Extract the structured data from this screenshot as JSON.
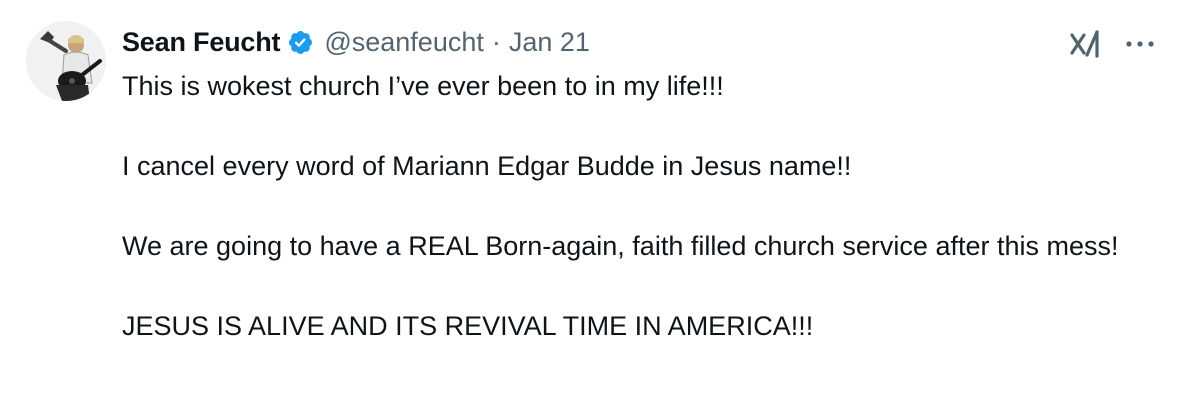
{
  "tweet": {
    "display_name": "Sean Feucht",
    "handle": "@seanfeucht",
    "separator": "·",
    "date": "Jan 21",
    "paragraphs": [
      "This is wokest church I’ve ever been to in my life!!!",
      "I cancel every word of Mariann Edgar Budde in Jesus name!!",
      "We are going to have a REAL Born-again, faith filled church service after this mess!",
      "JESUS IS ALIVE AND ITS REVIVAL TIME IN AMERICA!!!"
    ]
  },
  "icons": {
    "verified": "verified-badge-icon",
    "grok": "grok-icon",
    "more": "more-options-icon"
  },
  "colors": {
    "text": "#0f1419",
    "secondary": "#536471",
    "verified_blue": "#1d9bf0"
  }
}
